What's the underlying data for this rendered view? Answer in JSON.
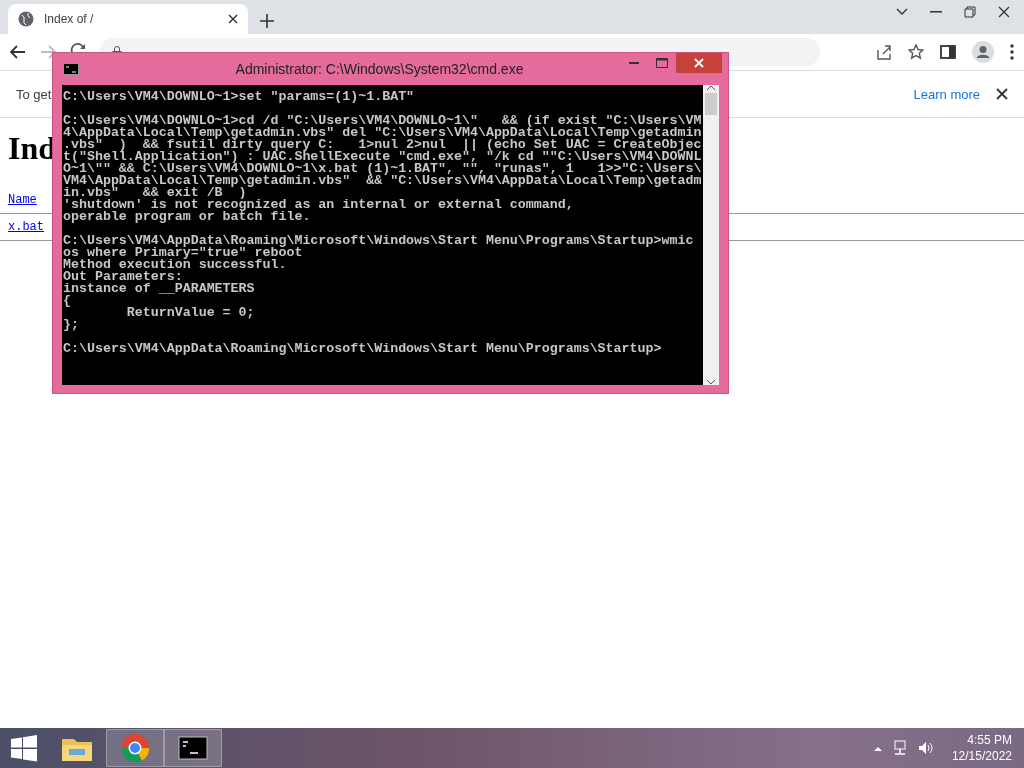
{
  "browser": {
    "tabs": [
      {
        "title": "Index of /",
        "selected": true
      }
    ],
    "toolbar": {
      "forward_disabled": true
    },
    "infobar": {
      "text": "To get",
      "link": "Learn more"
    },
    "page": {
      "heading": "Ind",
      "links": [
        "Name",
        "x.bat"
      ]
    }
  },
  "console_window": {
    "title": "Administrator: C:\\Windows\\System32\\cmd.exe",
    "blocks": [
      [
        "C:\\Users\\VM4\\DOWNLO~1>set \"params=(1)~1.BAT\""
      ],
      [
        "C:\\Users\\VM4\\DOWNLO~1>cd /d \"C:\\Users\\VM4\\DOWNLO~1\\\"   && (if exist \"C:\\Users\\VM",
        "4\\AppData\\Local\\Temp\\getadmin.vbs\" del \"C:\\Users\\VM4\\AppData\\Local\\Temp\\getadmin",
        ".vbs\"  )  && fsutil dirty query C:   1>nul 2>nul  || (echo Set UAC = CreateObjec",
        "t(\"Shell.Application\") : UAC.ShellExecute \"cmd.exe\", \"/k cd \"\"C:\\Users\\VM4\\DOWNL",
        "O~1\\\"\" && C:\\Users\\VM4\\DOWNLO~1\\x.bat (1)~1.BAT\", \"\", \"runas\", 1   1>>\"C:\\Users\\",
        "VM4\\AppData\\Local\\Temp\\getadmin.vbs\"  && \"C:\\Users\\VM4\\AppData\\Local\\Temp\\getadm",
        "in.vbs\"   && exit /B  )",
        "'shutdown' is not recognized as an internal or external command,",
        "operable program or batch file."
      ],
      [
        "C:\\Users\\VM4\\AppData\\Roaming\\Microsoft\\Windows\\Start Menu\\Programs\\Startup>wmic",
        "os where Primary=\"true\" reboot",
        "Method execution successful.",
        "Out Parameters:",
        "instance of __PARAMETERS",
        "{",
        "        ReturnValue = 0;",
        "};"
      ],
      [
        "C:\\Users\\VM4\\AppData\\Roaming\\Microsoft\\Windows\\Start Menu\\Programs\\Startup>"
      ]
    ]
  },
  "taskbar": {
    "apps": [
      {
        "kind": "explorer",
        "selected": false
      },
      {
        "kind": "chrome",
        "selected": true
      },
      {
        "kind": "console",
        "selected": true
      }
    ],
    "time": "4:55 PM",
    "date": "12/15/2022"
  }
}
